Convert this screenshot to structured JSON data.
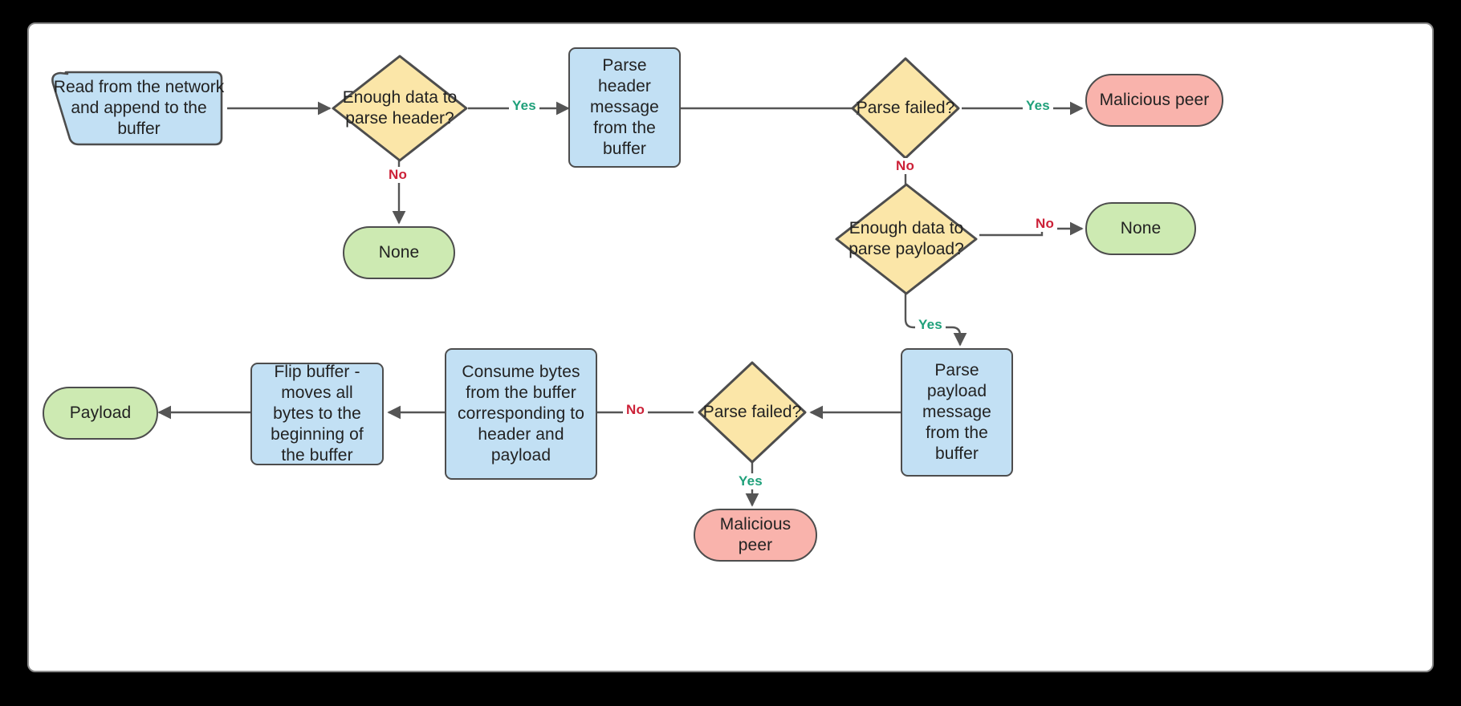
{
  "diagram": {
    "title": "Network message parsing flowchart",
    "colors": {
      "process_fill": "#c2e0f4",
      "decision_fill": "#fbe6a8",
      "terminal_fill": "#cdeab2",
      "error_fill": "#f9b3ac",
      "stroke": "#4d4d4d",
      "edge": "#555555",
      "label_yes": "#1fa07a",
      "label_no": "#cc2138",
      "canvas": "#ffffff",
      "background": "#000000"
    },
    "nodes": {
      "read_network": "Read from the network and append to the buffer",
      "enough_header": "Enough data to parse header?",
      "none_header": "None",
      "parse_header": "Parse header message from the buffer",
      "parse_failed_header": "Parse failed?",
      "malicious_header": "Malicious peer",
      "enough_payload": "Enough data to parse payload?",
      "none_payload": "None",
      "parse_payload": "Parse payload message from the buffer",
      "parse_failed_payload": "Parse failed?",
      "malicious_payload": "Malicious peer",
      "consume_bytes": "Consume bytes from the buffer corresponding to header and payload",
      "flip_buffer": "Flip buffer - moves all bytes to the beginning of the buffer",
      "payload": "Payload"
    },
    "edge_labels": {
      "header_yes": "Yes",
      "header_no": "No",
      "failed_header_yes": "Yes",
      "failed_header_no": "No",
      "payload_no": "No",
      "payload_yes": "Yes",
      "failed_payload_no": "No",
      "failed_payload_yes": "Yes"
    }
  }
}
